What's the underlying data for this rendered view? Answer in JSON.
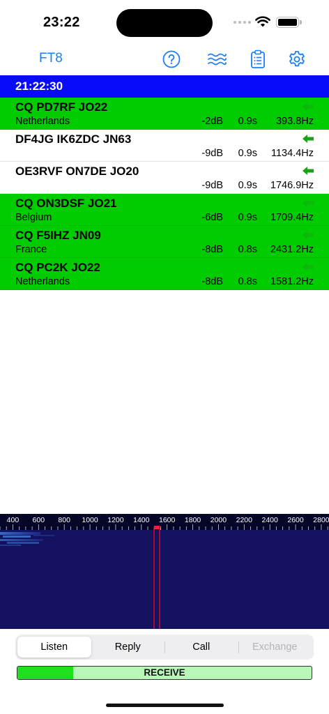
{
  "status_bar": {
    "time": "23:22"
  },
  "nav": {
    "title": "FT8",
    "buttons": [
      "help-icon",
      "waterfall-icon",
      "log-clipboard-icon",
      "settings-gear-icon"
    ]
  },
  "time_header": "21:22:30",
  "messages": [
    {
      "text": "CQ PD7RF JO22",
      "country": "Netherlands",
      "db": "-2dB",
      "dt": "0.9s",
      "freq": "393.8Hz",
      "cq": true
    },
    {
      "text": "DF4JG IK6ZDC JN63",
      "country": "",
      "db": "-9dB",
      "dt": "0.9s",
      "freq": "1134.4Hz",
      "cq": false
    },
    {
      "text": "OE3RVF ON7DE JO20",
      "country": "",
      "db": "-9dB",
      "dt": "0.9s",
      "freq": "1746.9Hz",
      "cq": false
    },
    {
      "text": "CQ ON3DSF JO21",
      "country": "Belgium",
      "db": "-6dB",
      "dt": "0.9s",
      "freq": "1709.4Hz",
      "cq": true
    },
    {
      "text": "CQ F5IHZ JN09",
      "country": "France",
      "db": "-8dB",
      "dt": "0.8s",
      "freq": "2431.2Hz",
      "cq": true
    },
    {
      "text": "CQ PC2K JO22",
      "country": "Netherlands",
      "db": "-8dB",
      "dt": "0.8s",
      "freq": "1581.2Hz",
      "cq": true
    }
  ],
  "waterfall": {
    "scale_labels": [
      "400",
      "600",
      "800",
      "1000",
      "1200",
      "1400",
      "1600",
      "1800",
      "2000",
      "2200",
      "2400",
      "2600",
      "2800"
    ],
    "scale_start_hz": 300,
    "scale_end_hz": 2860,
    "tx_marker_hz": 1520
  },
  "mode_control": {
    "segments": [
      {
        "label": "Listen",
        "selected": true,
        "disabled": false
      },
      {
        "label": "Reply",
        "selected": false,
        "disabled": false
      },
      {
        "label": "Call",
        "selected": false,
        "disabled": false
      },
      {
        "label": "Exchange",
        "selected": false,
        "disabled": true
      }
    ]
  },
  "receive": {
    "label": "RECEIVE",
    "progress": 0.19
  },
  "colors": {
    "accent": "#1a7ef5",
    "time_header": "#0a0afa",
    "cq_row": "#00cc00",
    "arrow": "#16a316",
    "waterfall_bg": "#12125e"
  }
}
